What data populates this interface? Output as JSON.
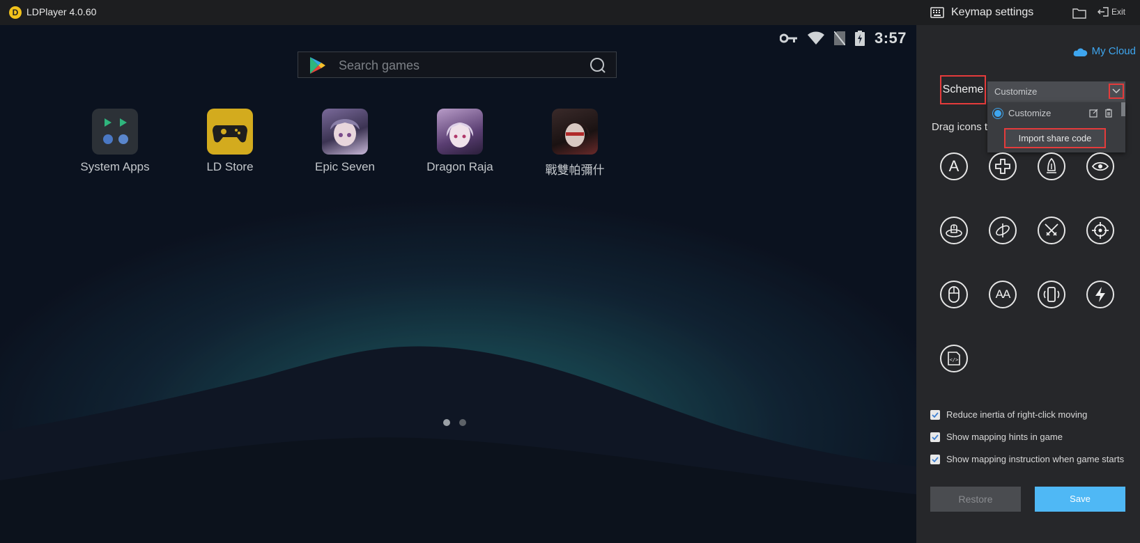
{
  "app": {
    "title": "LDPlayer 4.0.60",
    "logo_letter": "D"
  },
  "status_bar": {
    "time": "3:57"
  },
  "search": {
    "placeholder": "Search games"
  },
  "apps": [
    {
      "label": "System Apps"
    },
    {
      "label": "LD Store"
    },
    {
      "label": "Epic Seven"
    },
    {
      "label": "Dragon Raja"
    },
    {
      "label": "戰雙帕彌什"
    }
  ],
  "page_indicator": {
    "pages": 2,
    "current": 1
  },
  "keymap": {
    "title": "Keymap settings",
    "exit_label": "Exit",
    "my_cloud": "My Cloud",
    "scheme_label": "Scheme",
    "scheme_value": "Customize",
    "dropdown_item": "Customize",
    "import_label": "Import share code",
    "drag_text": "Drag icons t",
    "tools": [
      "tap-key",
      "dpad",
      "skill",
      "watch-view",
      "mouse-look",
      "rotate-view",
      "fight",
      "aim",
      "mouse",
      "repeat-tap",
      "shake",
      "fire",
      "macro"
    ],
    "checkboxes": [
      {
        "label": "Reduce inertia of right-click moving",
        "checked": true
      },
      {
        "label": "Show mapping hints in game",
        "checked": true
      },
      {
        "label": "Show mapping instruction when game starts",
        "checked": true
      }
    ],
    "restore_label": "Restore",
    "save_label": "Save"
  },
  "colors": {
    "accent": "#3ea6ef",
    "highlight": "#e53b3b",
    "save": "#4fb8f5"
  }
}
